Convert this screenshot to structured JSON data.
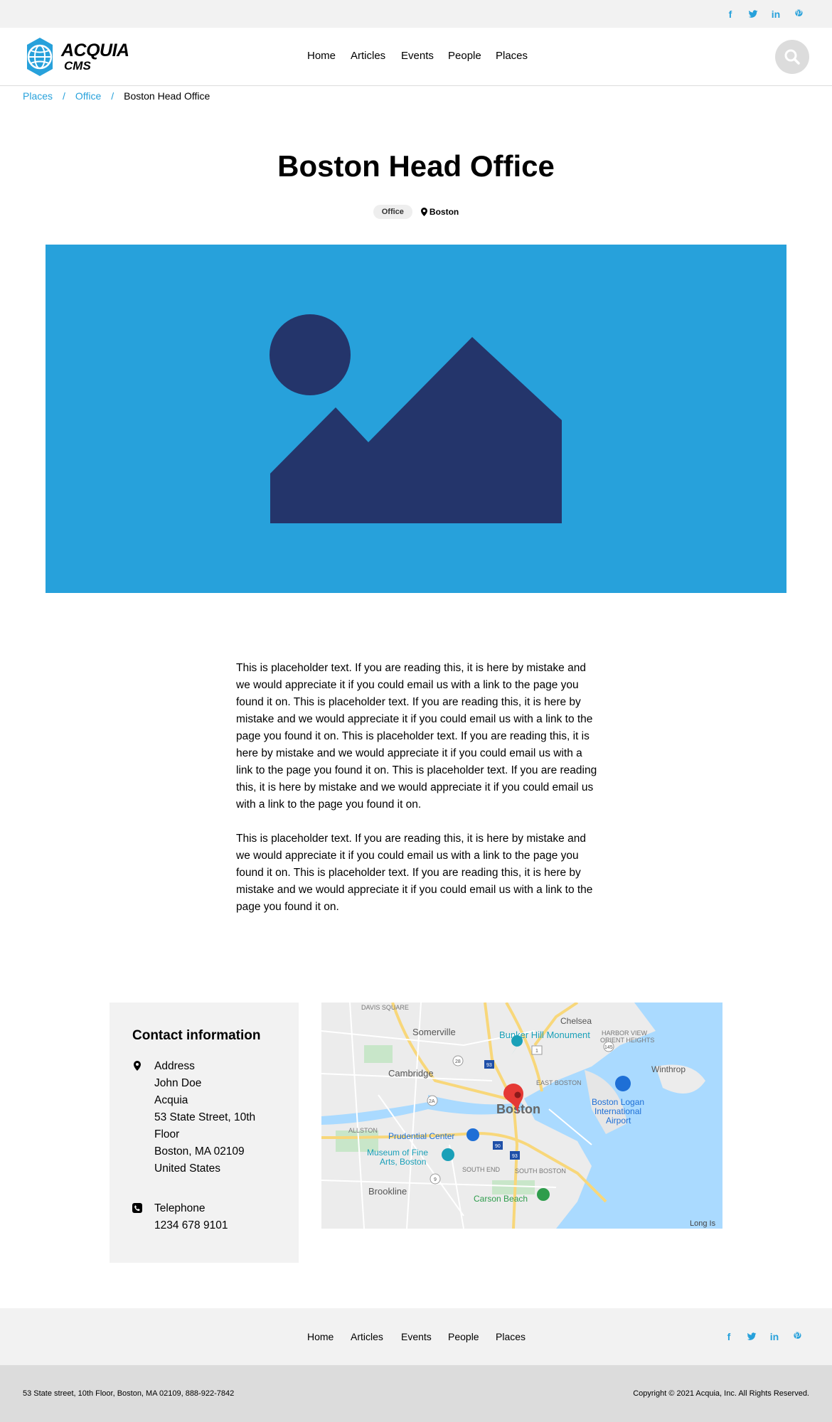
{
  "social": {
    "facebook": "f",
    "twitter": "twitter-icon",
    "linkedin": "in",
    "pinterest": "pinterest-icon"
  },
  "header": {
    "logo_line1": "ACQUIA",
    "logo_line2": "CMS",
    "nav": [
      "Home",
      "Articles",
      "Events",
      "People",
      "Places"
    ]
  },
  "breadcrumb": {
    "items": [
      "Places",
      "Office"
    ],
    "separator": "/",
    "current": "Boston Head Office"
  },
  "page": {
    "title": "Boston Head Office",
    "tag": "Office",
    "location": "Boston"
  },
  "body": {
    "paragraphs": [
      "This is placeholder text. If you are reading this, it is here by mistake and we would appreciate it if you could email us with a link to the page you found it on. This is placeholder text. If you are reading this, it is here by mistake and we would appreciate it if you could email us with a link to the page you found it on. This is placeholder text. If you are reading this, it is here by mistake and we would appreciate it if you could email us with a link to the page you found it on. This is placeholder text. If you are reading this, it is here by mistake and we would appreciate it if you could email us with a link to the page you found it on.",
      "This is placeholder text. If you are reading this, it is here by mistake and we would appreciate it if you could email us with a link to the page you found it on. This is placeholder text. If you are reading this, it is here by mistake and we would appreciate it if you could email us with a link to the page you found it on."
    ]
  },
  "contact": {
    "heading": "Contact information",
    "address_label": "Address",
    "address_lines": [
      "John Doe",
      "Acquia",
      "53 State Street, 10th",
      "Floor",
      "Boston, MA 02109",
      "United States"
    ],
    "telephone_label": "Telephone",
    "telephone": "1234 678 9101"
  },
  "map": {
    "labels": [
      "DAVIS SQUARE",
      "Somerville",
      "Bunker Hill Monument",
      "Chelsea",
      "HARBOR VIEW",
      "ORIENT HEIGHTS",
      "Cambridge",
      "Winthrop",
      "EAST BOSTON",
      "Boston",
      "Boston Logan",
      "International",
      "Airport",
      "ALLSTON",
      "Prudential Center",
      "Museum of Fine",
      "Arts, Boston",
      "SOUTH END",
      "SOUTH BOSTON",
      "Brookline",
      "Carson Beach",
      "Long Is"
    ],
    "shields": [
      "28",
      "1",
      "145",
      "2A",
      "93",
      "90",
      "9",
      "93"
    ]
  },
  "footer": {
    "nav": [
      "Home",
      "Articles",
      "Events",
      "People",
      "Places"
    ],
    "address": "53 State street, 10th Floor, Boston, MA 02109, 888-922-7842",
    "copyright": "Copyright © 2021 Acquia, Inc. All Rights Reserved."
  },
  "colors": {
    "accent": "#27a1db",
    "hero_bg": "#27a1db",
    "hero_shape": "#24356b",
    "topbar_bg": "#f2f2f2",
    "footer_bg": "#dcdcdc",
    "map_water": "#aadaff",
    "map_pin": "#e53935"
  }
}
